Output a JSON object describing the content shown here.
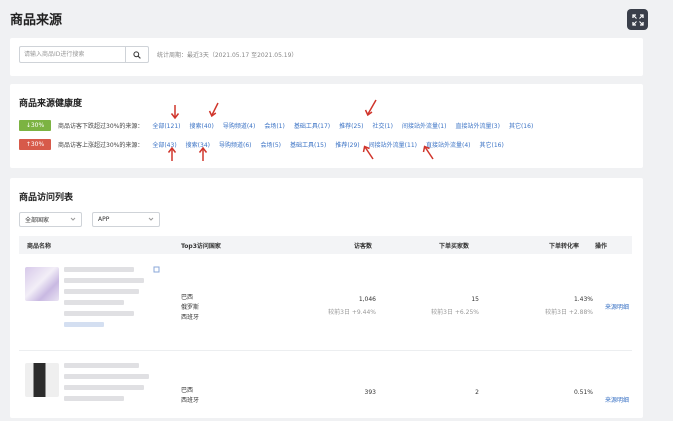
{
  "page": {
    "title": "商品来源"
  },
  "search": {
    "placeholder": "请输入商品ID进行搜索",
    "period": "统计周期：最近3天（2021.05.17 至2021.05.19）"
  },
  "health": {
    "title": "商品来源健康度",
    "rows": [
      {
        "badge": "↓30%",
        "label": "商品访客下跌超过30%的来源：",
        "sources": [
          "全部(121)",
          "搜索(40)",
          "导购频道(4)",
          "会场(1)",
          "基础工具(17)",
          "推荐(25)",
          "社交(1)",
          "间接站外流量(1)",
          "直接站外流量(3)",
          "其它(16)"
        ]
      },
      {
        "badge": "↑30%",
        "label": "商品访客上涨超过30%的来源：",
        "sources": [
          "全部(43)",
          "搜索(34)",
          "导购频道(6)",
          "会场(5)",
          "基础工具(15)",
          "推荐(29)",
          "间接站外流量(11)",
          "直接站外流量(4)",
          "其它(16)"
        ]
      }
    ],
    "badge_colors": {
      "down": "#7cb342",
      "up": "#d75a4a"
    },
    "arrow_color": "#d0352b"
  },
  "list": {
    "title": "商品访问列表",
    "filters": {
      "country": "全部国家",
      "platform": "APP"
    },
    "columns": [
      "商品名称",
      "Top3访问国家",
      "访客数",
      "下单买家数",
      "下单转化率",
      "操作"
    ],
    "rows": [
      {
        "countries": [
          "巴西",
          "俄罗斯",
          "西班牙"
        ],
        "visitors": "1,046",
        "visitors_cmp": "较前3日 +9.44%",
        "buyers": "15",
        "buyers_cmp": "较前3日 +6.25%",
        "rate": "1.43%",
        "rate_cmp": "较前3日 +2.88%",
        "action": "来源明细"
      },
      {
        "countries": [
          "巴西",
          "西班牙"
        ],
        "visitors": "393",
        "buyers": "2",
        "rate": "0.51%",
        "action": "来源明细"
      }
    ]
  }
}
